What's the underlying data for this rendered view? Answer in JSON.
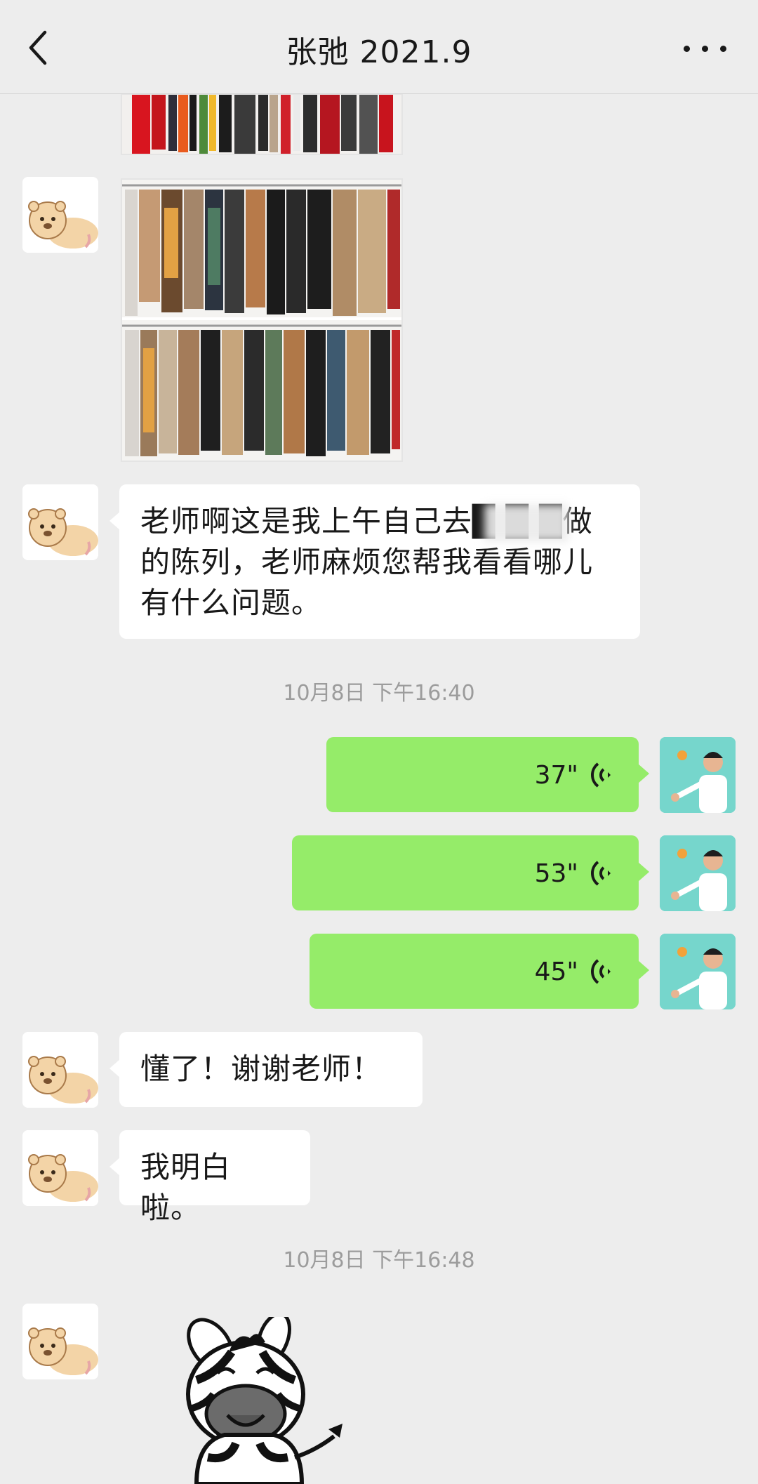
{
  "header": {
    "title": "张弛 2021.9"
  },
  "messages": {
    "text1": "老师啊这是我上午自己去█ █ █做的陈列，老师麻烦您帮我看看哪儿有什么问题。",
    "time1": "10月8日 下午16:40",
    "voice1": "37\"",
    "voice2": "53\"",
    "voice3": "45\"",
    "text2": "懂了！谢谢老师！",
    "text3": "我明白啦。",
    "time2": "10月8日 下午16:48"
  },
  "icons": {
    "back": "chevron-left-icon",
    "more": "more-dots-icon",
    "voice": "voice-wave-icon"
  },
  "colors": {
    "background": "#ededed",
    "bubble_sent": "#95ec69",
    "bubble_received": "#ffffff",
    "timestamp": "#9c9c9c"
  }
}
